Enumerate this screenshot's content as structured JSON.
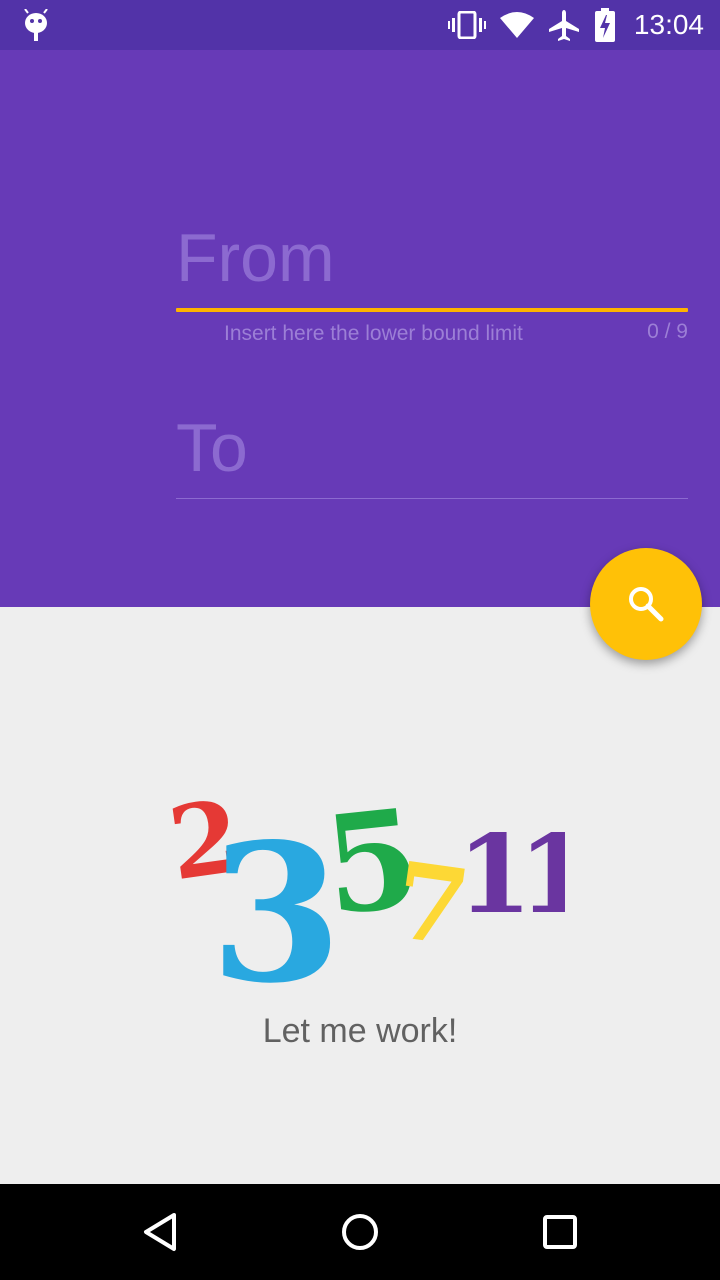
{
  "status_bar": {
    "time": "13:04",
    "icons": [
      "android-icon",
      "vibrate-icon",
      "wifi-icon",
      "airplane-icon",
      "battery-charging-icon"
    ]
  },
  "form": {
    "from_placeholder": "From",
    "from_helper": "Insert here the lower bound limit",
    "from_counter": "0 / 9",
    "to_placeholder": "To"
  },
  "fab": {
    "icon": "search-icon"
  },
  "logo": {
    "digits": [
      "2",
      "3",
      "5",
      "7",
      "11"
    ],
    "colors": [
      "#e53935",
      "#29a8e0",
      "#1faa4a",
      "#fdd835",
      "#6a35a0"
    ]
  },
  "message": "Let me work!",
  "nav_bar": {
    "icons": [
      "back-icon",
      "home-icon",
      "recents-icon"
    ]
  },
  "colors": {
    "primary": "#673ab7",
    "primary_dark": "#5233a8",
    "accent": "#ffc107"
  }
}
